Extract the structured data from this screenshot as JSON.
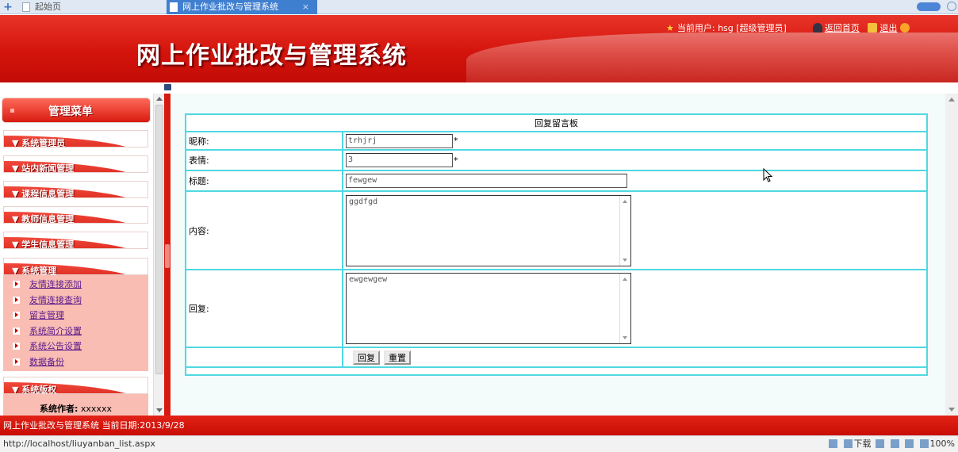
{
  "browser": {
    "tabs": [
      {
        "label": "起始页"
      },
      {
        "label": "网上作业批改与管理系统",
        "close": "×"
      }
    ]
  },
  "header": {
    "site_title": "网上作业批改与管理系统",
    "current_user": "当前用户: hsg [超级管理员]",
    "home_link": "返回首页",
    "logout_link": "退出"
  },
  "sidebar": {
    "menu_title": "管理菜单",
    "groups": [
      {
        "label": "▼ 系统管理员"
      },
      {
        "label": "▼ 站内新闻管理"
      },
      {
        "label": "▼ 课程信息管理"
      },
      {
        "label": "▼ 教师信息管理"
      },
      {
        "label": "▼ 学生信息管理"
      },
      {
        "label": "▼  系统管理"
      }
    ],
    "system_items": [
      "友情连接添加",
      "友情连接查询",
      "留言管理",
      "系统简介设置",
      "系统公告设置",
      "数据备份"
    ],
    "copyright_title": "▼  系统版权",
    "author_label": "系统作者:",
    "author_value": "xxxxxx"
  },
  "form": {
    "title": "回复留言板",
    "nickname_label": "昵称:",
    "nickname_value": "trhjrj",
    "emotion_label": "表情:",
    "emotion_value": "3",
    "required_mark": "*",
    "subject_label": "标题:",
    "subject_value": "fewgew",
    "content_label": "内容:",
    "content_value": "ggdfgd",
    "reply_label": "回复:",
    "reply_value": "ewgewgew",
    "reply_button": "回复",
    "reset_button": "重置"
  },
  "status": {
    "text": "网上作业批改与管理系统 当前日期:2013/9/28"
  },
  "browser_status": {
    "url": "http://localhost/liuyanban_list.aspx",
    "download": "下载",
    "zoom": "100%"
  }
}
